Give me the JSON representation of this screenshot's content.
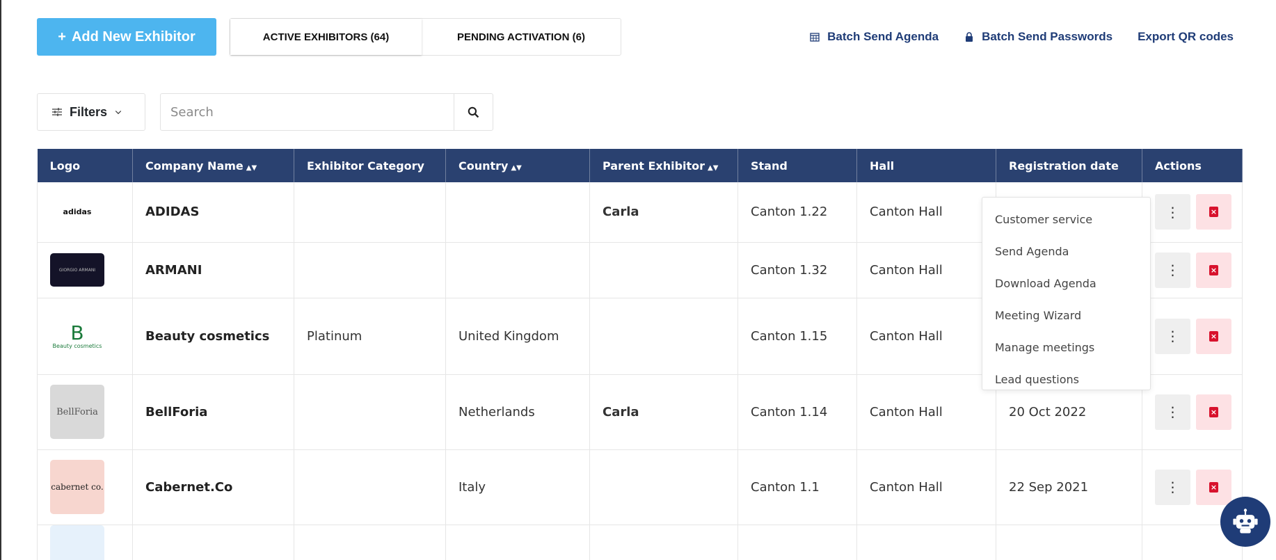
{
  "toolbar": {
    "add_label": "Add New Exhibitor",
    "tabs": [
      {
        "label": "ACTIVE EXHIBITORS (64)",
        "active": true
      },
      {
        "label": "PENDING ACTIVATION (6)",
        "active": false
      }
    ],
    "links": [
      {
        "label": "Batch Send Agenda",
        "icon": "calendar-icon"
      },
      {
        "label": "Batch Send Passwords",
        "icon": "lock-icon"
      },
      {
        "label": "Export QR codes",
        "icon": ""
      }
    ]
  },
  "filters": {
    "label": "Filters"
  },
  "search": {
    "placeholder": "Search"
  },
  "table": {
    "headers": [
      "Logo",
      "Company Name",
      "Exhibitor Category",
      "Country",
      "Parent Exhibitor",
      "Stand",
      "Hall",
      "Registration date",
      "Actions"
    ],
    "sortable": [
      false,
      true,
      false,
      true,
      true,
      false,
      false,
      false,
      false
    ],
    "rows": [
      {
        "logo_text": "adidas",
        "company": "ADIDAS",
        "category": "",
        "country": "",
        "parent": "Carla",
        "stand": "Canton 1.22",
        "hall": "Canton Hall",
        "date": ""
      },
      {
        "logo_text": "GIORGIO ARMANI",
        "company": "ARMANI",
        "category": "",
        "country": "",
        "parent": "",
        "stand": "Canton 1.32",
        "hall": "Canton Hall",
        "date": ""
      },
      {
        "logo_text": "Beauty cosmetics",
        "company": "Beauty cosmetics",
        "category": "Platinum",
        "country": "United Kingdom",
        "parent": "",
        "stand": "Canton 1.15",
        "hall": "Canton Hall",
        "date": ""
      },
      {
        "logo_text": "BellForia",
        "company": "BellForia",
        "category": "",
        "country": "Netherlands",
        "parent": "Carla",
        "stand": "Canton 1.14",
        "hall": "Canton Hall",
        "date": "20 Oct 2022"
      },
      {
        "logo_text": "cabernet co.",
        "company": "Cabernet.Co",
        "category": "",
        "country": "Italy",
        "parent": "",
        "stand": "Canton 1.1",
        "hall": "Canton Hall",
        "date": "22 Sep 2021"
      }
    ]
  },
  "dropdown": {
    "items": [
      "Customer service",
      "Send Agenda",
      "Download Agenda",
      "Meeting Wizard",
      "Manage meetings",
      "Lead questions"
    ]
  },
  "colors": {
    "accent": "#4db5ef",
    "header": "#2a4170",
    "link": "#1f3c77",
    "danger": "#d8122d"
  }
}
